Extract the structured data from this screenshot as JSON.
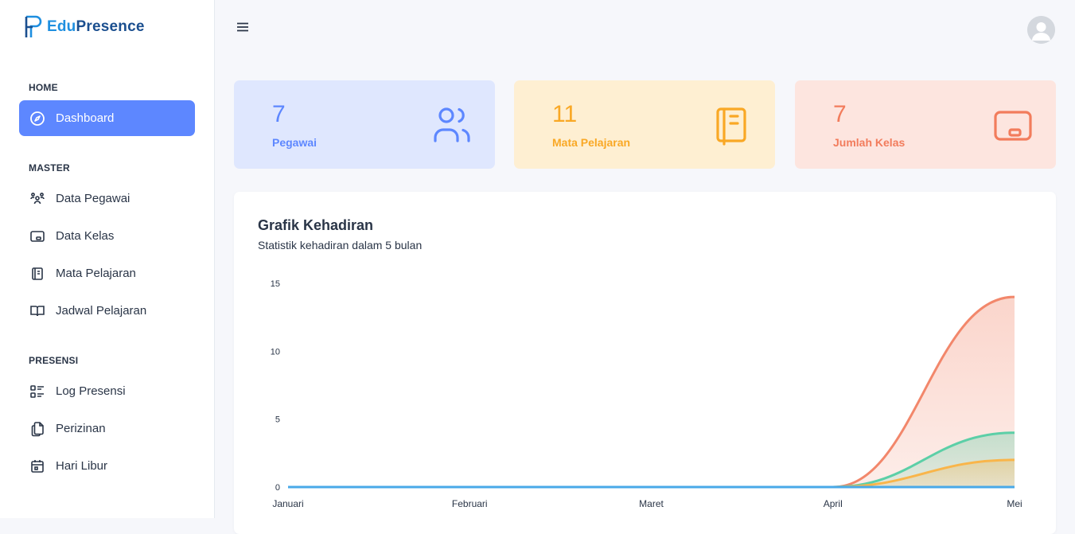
{
  "brand": {
    "name_part1": "Edu",
    "name_part2": "Presence"
  },
  "sidebar": {
    "sections": [
      {
        "title": "HOME",
        "items": [
          {
            "label": "Dashboard",
            "icon": "compass-icon",
            "active": true
          }
        ]
      },
      {
        "title": "MASTER",
        "items": [
          {
            "label": "Data Pegawai",
            "icon": "users-group-icon"
          },
          {
            "label": "Data Kelas",
            "icon": "chalkboard-icon"
          },
          {
            "label": "Mata Pelajaran",
            "icon": "notebook-icon"
          },
          {
            "label": "Jadwal Pelajaran",
            "icon": "book-open-icon"
          }
        ]
      },
      {
        "title": "PRESENSI",
        "items": [
          {
            "label": "Log Presensi",
            "icon": "list-details-icon"
          },
          {
            "label": "Perizinan",
            "icon": "files-icon"
          },
          {
            "label": "Hari Libur",
            "icon": "calendar-icon"
          }
        ]
      }
    ]
  },
  "topbar": {
    "menu_icon": "menu-icon",
    "avatar_icon": "user-avatar-icon"
  },
  "stats": [
    {
      "value": "7",
      "label": "Pegawai",
      "icon": "users-icon",
      "bg": "#dfe7fe",
      "fg": "#5d87ff"
    },
    {
      "value": "11",
      "label": "Mata Pelajaran",
      "icon": "notebook-icon",
      "bg": "#feefd2",
      "fg": "#f9a825"
    },
    {
      "value": "7",
      "label": "Jumlah Kelas",
      "icon": "chalkboard-icon",
      "bg": "#fde5df",
      "fg": "#f27c5c"
    }
  ],
  "chart": {
    "title": "Grafik Kehadiran",
    "subtitle": "Statistik kehadiran dalam 5 bulan"
  },
  "chart_data": {
    "type": "area",
    "categories": [
      "Januari",
      "Februari",
      "Maret",
      "April",
      "Mei"
    ],
    "ylim": [
      0,
      15
    ],
    "yticks": [
      "15",
      "10",
      "5",
      "0"
    ],
    "grid": false,
    "series": [
      {
        "values": [
          0,
          0,
          0,
          0,
          14
        ],
        "color": "#f2876b"
      },
      {
        "values": [
          0,
          0,
          0,
          0,
          4
        ],
        "color": "#5ccfa7"
      },
      {
        "values": [
          0,
          0,
          0,
          0,
          2
        ],
        "color": "#f9b54a"
      },
      {
        "values": [
          0,
          0,
          0,
          0,
          0
        ],
        "color": "#49a9e8"
      }
    ]
  }
}
